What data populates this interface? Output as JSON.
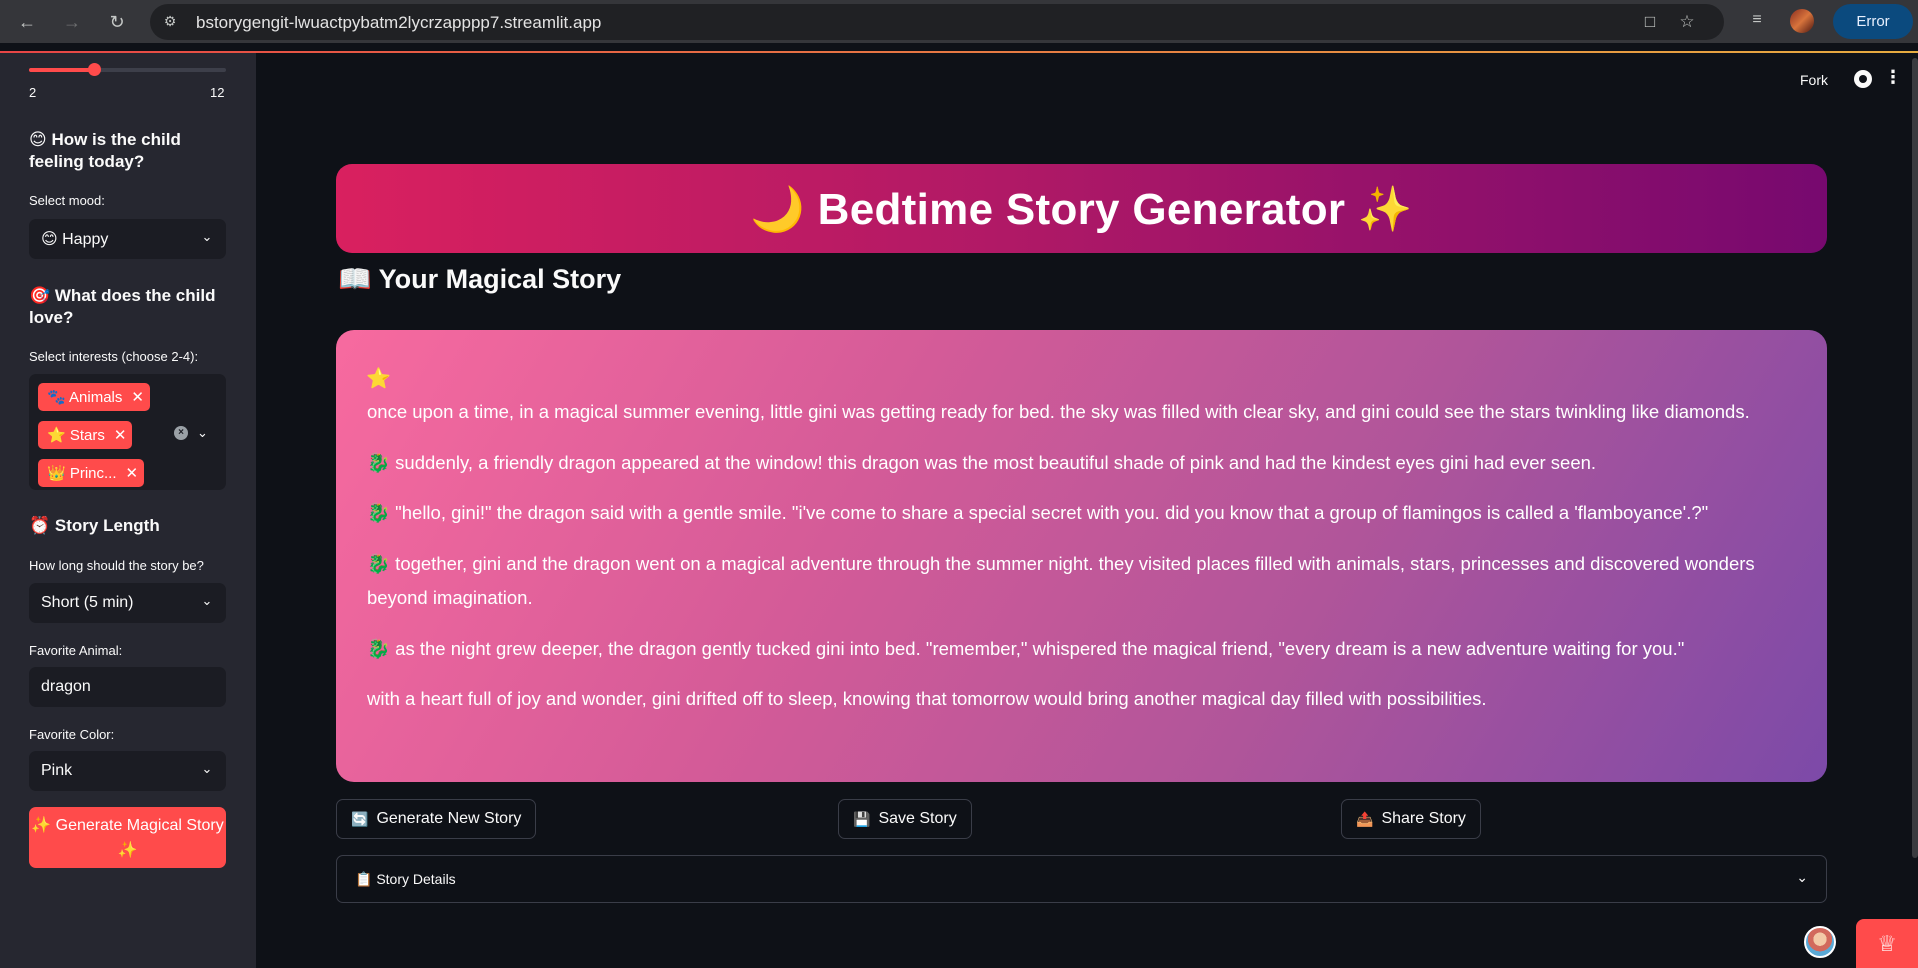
{
  "browser": {
    "url": "bstorygengit-lwuactpybatm2lycrzapppp7.streamlit.app",
    "error_label": "Error"
  },
  "sidebar": {
    "slider": {
      "min_label": "2",
      "max_label": "12",
      "value_fraction": 0.33
    },
    "mood": {
      "heading": "😊 How is the child feeling today?",
      "label": "Select mood:",
      "value": "😊 Happy"
    },
    "interests": {
      "heading": "🎯 What does the child love?",
      "label": "Select interests (choose 2-4):",
      "chips": [
        "🐾 Animals",
        "⭐ Stars",
        "👑 Princ..."
      ],
      "clear_symbol": "×"
    },
    "length": {
      "heading": "⏰ Story Length",
      "label": "How long should the story be?",
      "value": "Short (5 min)"
    },
    "animal": {
      "label": "Favorite Animal:",
      "value": "dragon"
    },
    "color": {
      "label": "Favorite Color:",
      "value": "Pink"
    },
    "generate_button": "✨ Generate Magical Story ✨"
  },
  "toolbar": {
    "fork_label": "Fork",
    "menu_symbol": "⋮"
  },
  "hero": {
    "title": "🌙 Bedtime Story Generator ✨"
  },
  "story_section": {
    "heading": "📖 Your Magical Story"
  },
  "story": {
    "star": "⭐",
    "paragraphs": [
      "once upon a time, in a magical summer evening, little gini was getting ready for bed. the sky was filled with clear sky, and gini could see the stars twinkling like diamonds.",
      "🐉 suddenly, a friendly dragon appeared at the window! this dragon was the most beautiful shade of pink and had the kindest eyes gini had ever seen.",
      "🐉 \"hello, gini!\" the dragon said with a gentle smile. \"i've come to share a special secret with you. did you know that a group of flamingos is called a 'flamboyance'.?\"",
      "🐉 together, gini and the dragon went on a magical adventure through the summer night. they visited places filled with animals, stars, princesses and discovered wonders beyond imagination.",
      "🐉 as the night grew deeper, the dragon gently tucked gini into bed. \"remember,\" whispered the magical friend, \"every dream is a new adventure waiting for you.\"",
      "with a heart full of joy and wonder, gini drifted off to sleep, knowing that tomorrow would bring another magical day filled with possibilities."
    ]
  },
  "actions": {
    "new_story": {
      "icon": "🔄",
      "label": "Generate New Story"
    },
    "save_story": {
      "icon": "💾",
      "label": "Save Story"
    },
    "share_story": {
      "icon": "📤",
      "label": "Share Story"
    }
  },
  "expander": {
    "label": "📋 Story Details"
  },
  "colors": {
    "accent": "#ff4b4b",
    "background": "#0e1117",
    "sidebar": "#262730"
  }
}
